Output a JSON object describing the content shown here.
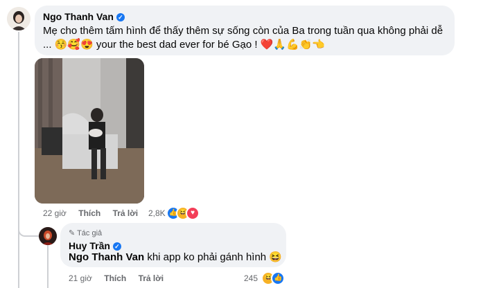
{
  "comment1": {
    "author": "Ngo Thanh Van",
    "verified_icon": "verified-badge-icon",
    "text_line1": "Mẹ cho thêm tấm hình để thấy thêm sự sống còn của Ba trong tuần qua không phải dễ",
    "text_line2_prefix": "... ",
    "emojis_a": "😚🥰😍",
    "text_line2_mid": " your the best dad ever for bé Gạo ! ",
    "emojis_b": "❤️🙏💪👏👈",
    "time": "22 giờ",
    "like_label": "Thích",
    "reply_label": "Trả lời",
    "reaction_count": "2,8K",
    "reactions": [
      "like",
      "haha",
      "love"
    ]
  },
  "reply1": {
    "badge": "Tác giả",
    "author": "Huy Trần",
    "mention": "Ngo Thanh Van",
    "text": " khi app ko phải gánh hình ",
    "emoji": "😆",
    "time": "21 giờ",
    "like_label": "Thích",
    "reply_label": "Trả lời",
    "reaction_count": "245",
    "reactions": [
      "haha",
      "like"
    ]
  },
  "colors": {
    "accent": "#1877f2",
    "bubble": "#f0f2f5",
    "meta": "#65676b"
  }
}
